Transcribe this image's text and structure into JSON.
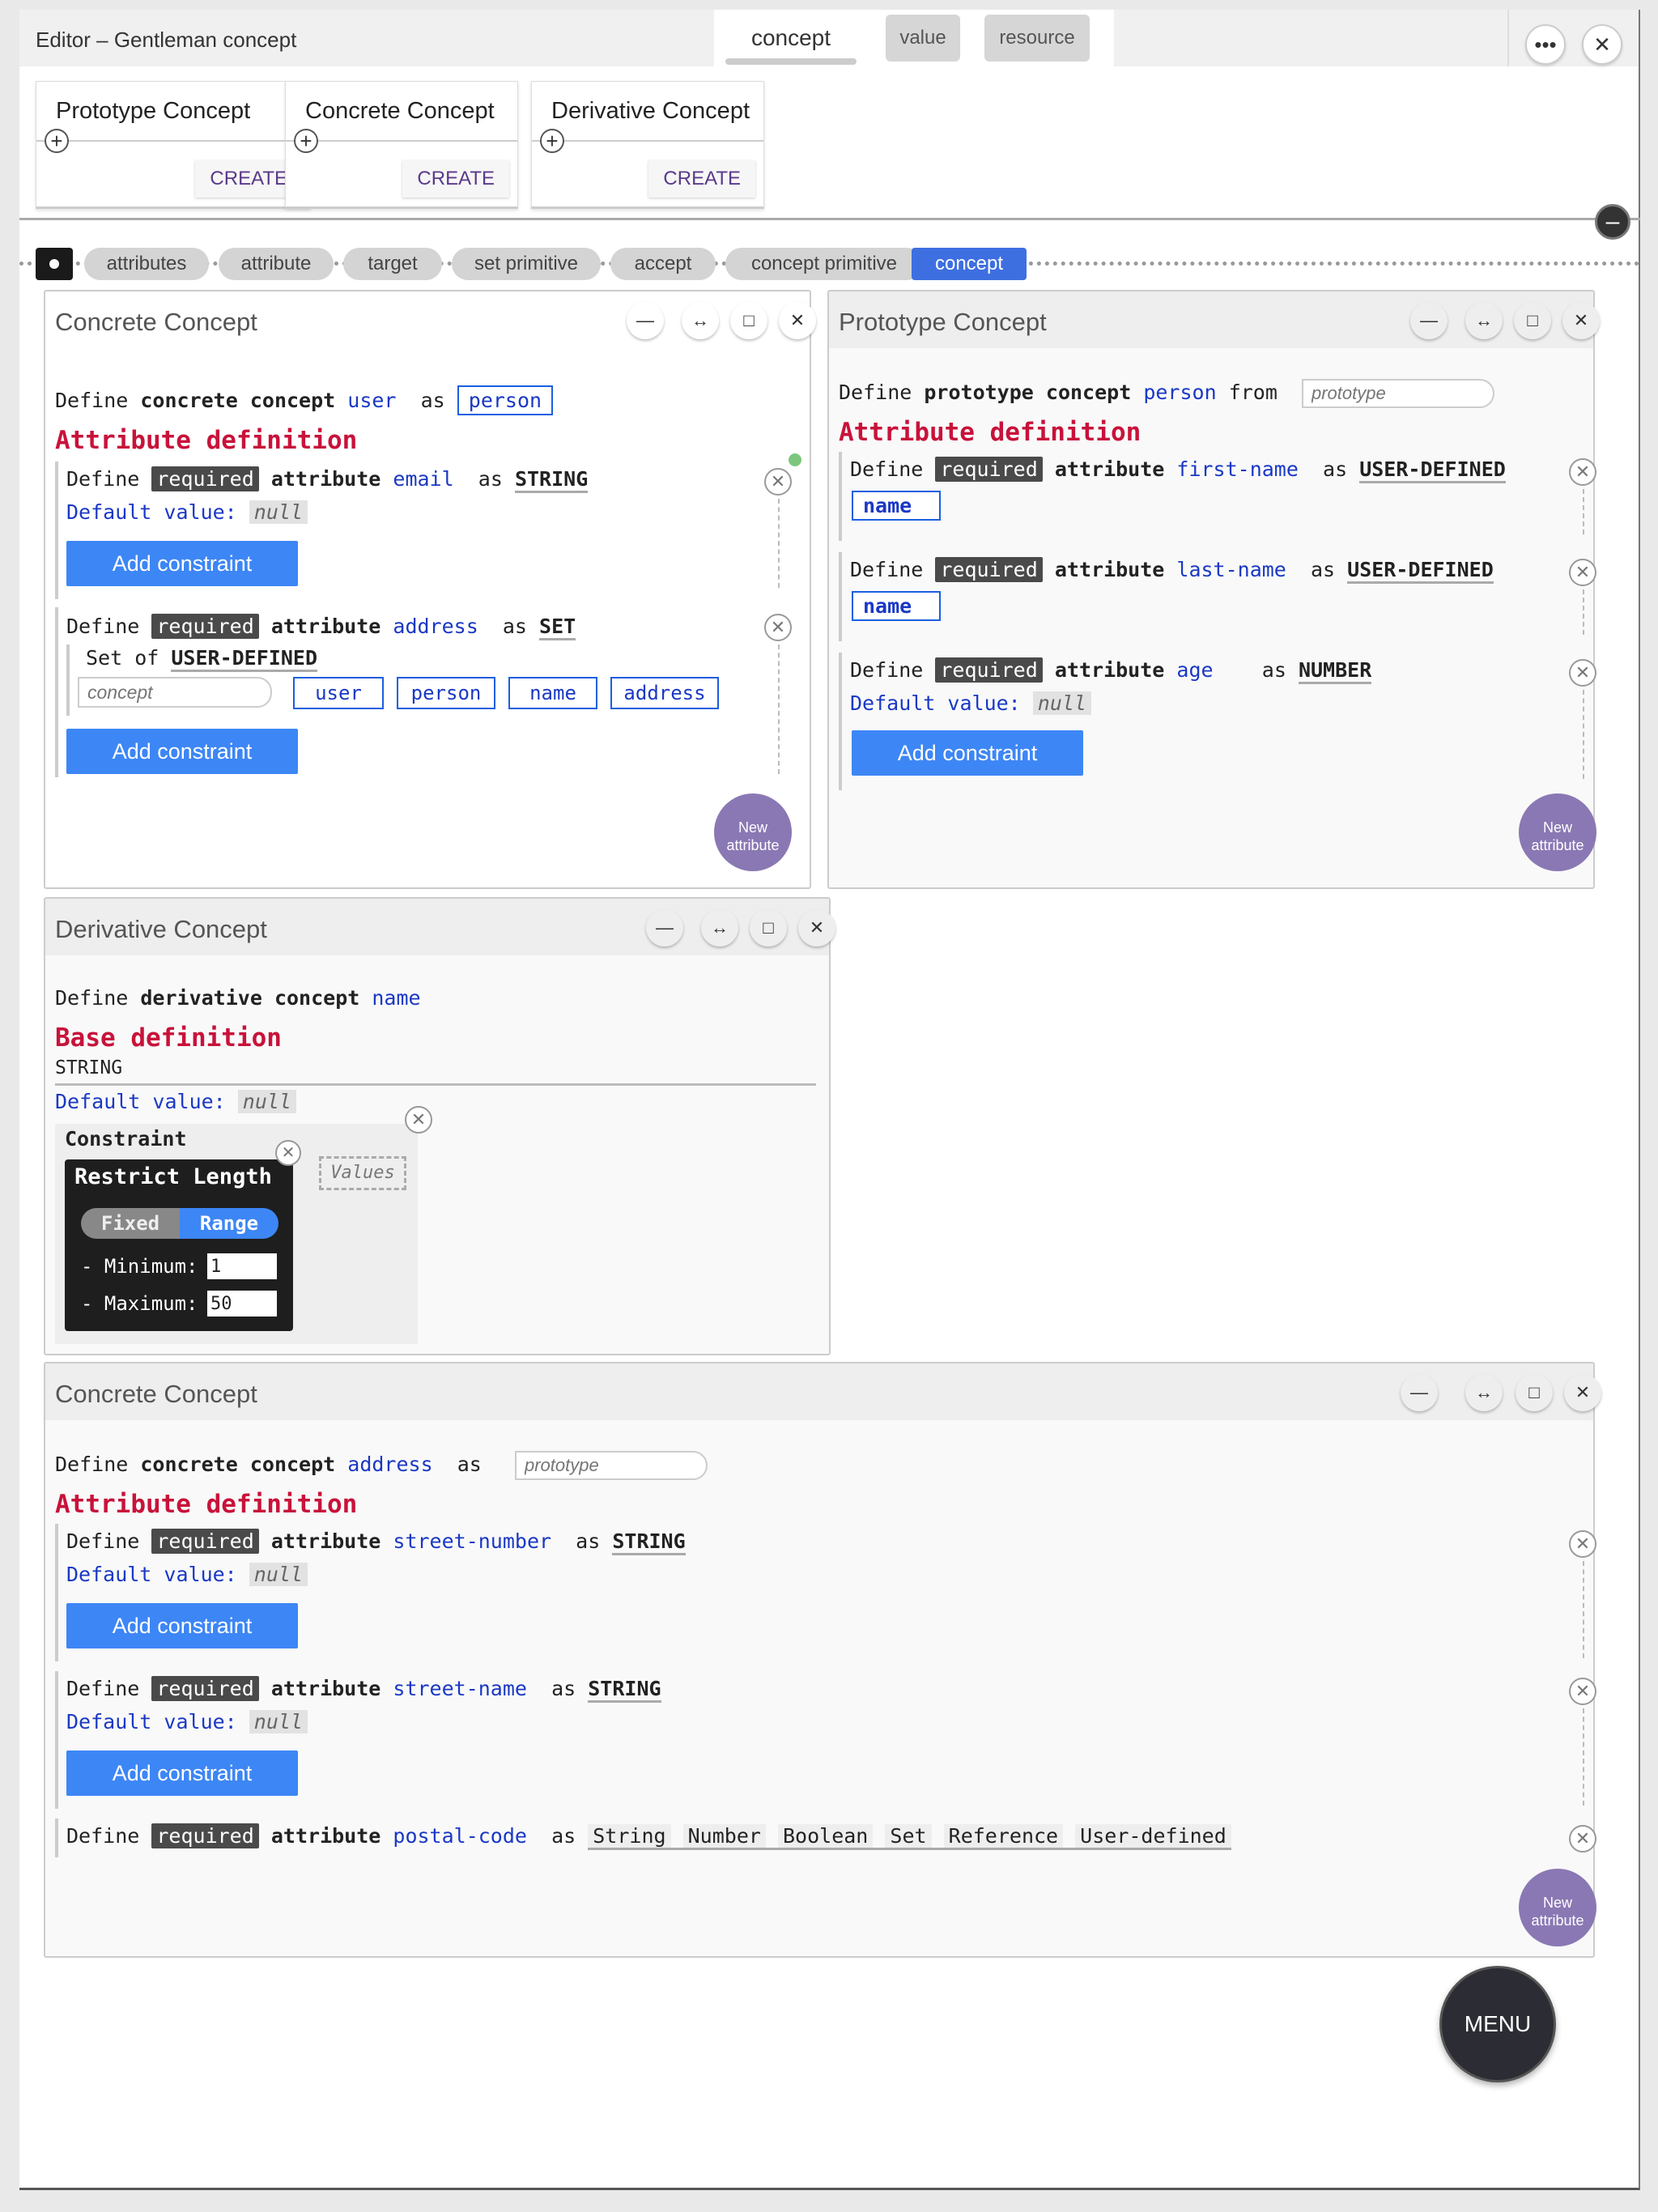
{
  "app": {
    "title": "Editor – Gentleman concept"
  },
  "tabs": {
    "concept": "concept",
    "value": "value",
    "resource": "resource"
  },
  "header": {
    "more": "•••",
    "close": "✕"
  },
  "create_cards": [
    {
      "title": "Prototype Concept",
      "button": "CREATE"
    },
    {
      "title": "Concrete Concept",
      "button": "CREATE"
    },
    {
      "title": "Derivative Concept",
      "button": "CREATE"
    }
  ],
  "breadcrumbs": [
    "attributes",
    "attribute",
    "target",
    "set primitive",
    "accept",
    "concept primitive",
    "concept"
  ],
  "common": {
    "define": "Define",
    "required": "required",
    "attribute": "attribute",
    "as": "as",
    "default_value": "Default value:",
    "null": "null",
    "add_constraint": "Add constraint",
    "attribute_definition": "Attribute definition",
    "new_attribute_line1": "New",
    "new_attribute_line2": "attribute",
    "minimize": "—",
    "expand": "↔",
    "maximize": "□",
    "close": "✕",
    "remove": "✕"
  },
  "panel_user": {
    "title": "Concrete Concept",
    "kind": "concrete concept",
    "name": "user",
    "base": "person",
    "attributes": [
      {
        "name": "email",
        "type": "STRING"
      },
      {
        "name": "address",
        "type": "SET",
        "set_of": "Set of",
        "set_type": "USER-DEFINED",
        "concept_placeholder": "concept",
        "options": [
          "user",
          "person",
          "name",
          "address"
        ]
      }
    ]
  },
  "panel_person": {
    "title": "Prototype Concept",
    "kind": "prototype concept",
    "name": "person",
    "from": "from",
    "placeholder": "prototype",
    "attributes": [
      {
        "name": "first-name",
        "type": "USER-DEFINED",
        "ref": "name"
      },
      {
        "name": "last-name",
        "type": "USER-DEFINED",
        "ref": "name"
      },
      {
        "name": "age",
        "type": "NUMBER"
      }
    ]
  },
  "panel_name": {
    "title": "Derivative Concept",
    "kind": "derivative concept",
    "name": "name",
    "base_header": "Base definition",
    "base_type": "STRING",
    "constraint_label": "Constraint",
    "restrict": {
      "title": "Restrict Length",
      "fixed": "Fixed",
      "range": "Range",
      "min_label": "- Minimum:",
      "max_label": "- Maximum:",
      "min": "1",
      "max": "50"
    },
    "values_placeholder": "Values"
  },
  "panel_address": {
    "title": "Concrete Concept",
    "kind": "concrete concept",
    "name": "address",
    "placeholder": "prototype",
    "attributes": [
      {
        "name": "street-number",
        "type": "STRING"
      },
      {
        "name": "street-name",
        "type": "STRING"
      },
      {
        "name": "postal-code",
        "type_options": [
          "String",
          "Number",
          "Boolean",
          "Set",
          "Reference",
          "User-defined"
        ]
      }
    ]
  },
  "menu": {
    "label": "MENU"
  },
  "colors": {
    "accent": "#3d86f5",
    "active_crumb": "#3e6fe0",
    "section_red": "#c8123a",
    "identifier": "#1a38c4",
    "fab": "#8a78b4"
  }
}
